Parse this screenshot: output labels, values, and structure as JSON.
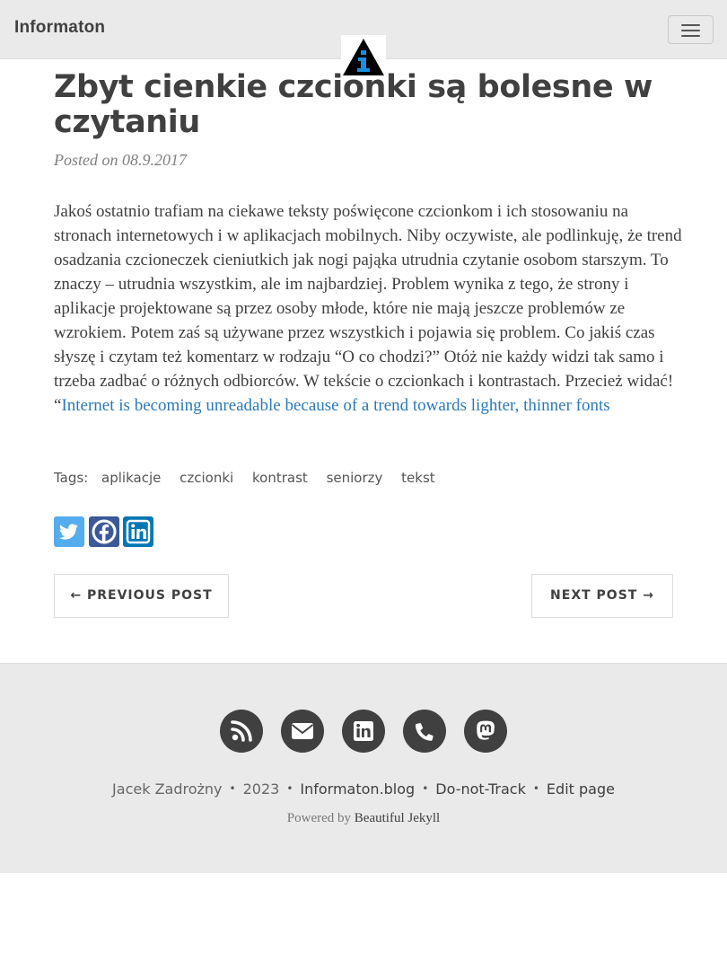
{
  "navbar": {
    "brand": "Informaton",
    "logo_icon": "informaton-triangle-logo",
    "menu_icon": "hamburger-menu-icon"
  },
  "post": {
    "title": "Zbyt cienkie czcionki są bolesne w czytaniu",
    "meta": "Posted on 08.9.2017",
    "body": "Jakoś ostatnio trafiam na ciekawe teksty poświęcone czcionkom i ich stosowaniu na stronach internetowych i w aplikacjach mobilnych. Niby oczywiste, ale podlinkuję, że trend osadzania czcioneczek cieniutkich jak nogi pająka utrudnia czytanie osobom starszym. To znaczy – utrudnia wszystkim, ale im najbardziej. Problem wynika z tego, że strony i aplikacje projektowane są przez osoby młode, które nie mają jeszcze problemów ze wzrokiem. Potem zaś są używane przez wszystkich i pojawia się problem. Co jakiś czas słyszę i czytam też komentarz w rodzaju “O co chodzi?” Otóż nie każdy widzi tak samo i trzeba zadbać o różnych odbiorców. W tekście o czcionkach i kontrastach. Przecież widać! “",
    "link_text": "Internet is becoming unreadable because of a trend towards lighter, thinner fonts"
  },
  "tags": {
    "label": "Tags:",
    "items": [
      "aplikacje",
      "czcionki",
      "kontrast",
      "seniorzy",
      "tekst"
    ]
  },
  "share": {
    "twitter_icon": "twitter-icon",
    "facebook_icon": "facebook-icon",
    "linkedin_icon": "linkedin-icon"
  },
  "pager": {
    "previous": "← PREVIOUS POST",
    "next": "NEXT POST →"
  },
  "footer": {
    "icons": [
      "rss-icon",
      "envelope-icon",
      "linkedin-icon",
      "phone-icon",
      "mastodon-icon"
    ],
    "author": "Jacek Zadrożny",
    "year": "2023",
    "site": "Informaton.blog",
    "dnt": "Do-not-Track",
    "edit": "Edit page",
    "separator": "•",
    "powered_prefix": "Powered by",
    "powered_link": "Beautiful Jekyll"
  },
  "colors": {
    "navbar_bg": "#eaeaea",
    "footer_bg": "#eaeaea",
    "text": "#404040",
    "link": "#2a7ab8",
    "twitter": "#55acee",
    "facebook": "#3b5998",
    "linkedin": "#0077b5",
    "logo_blue": "#1a8fe0"
  }
}
